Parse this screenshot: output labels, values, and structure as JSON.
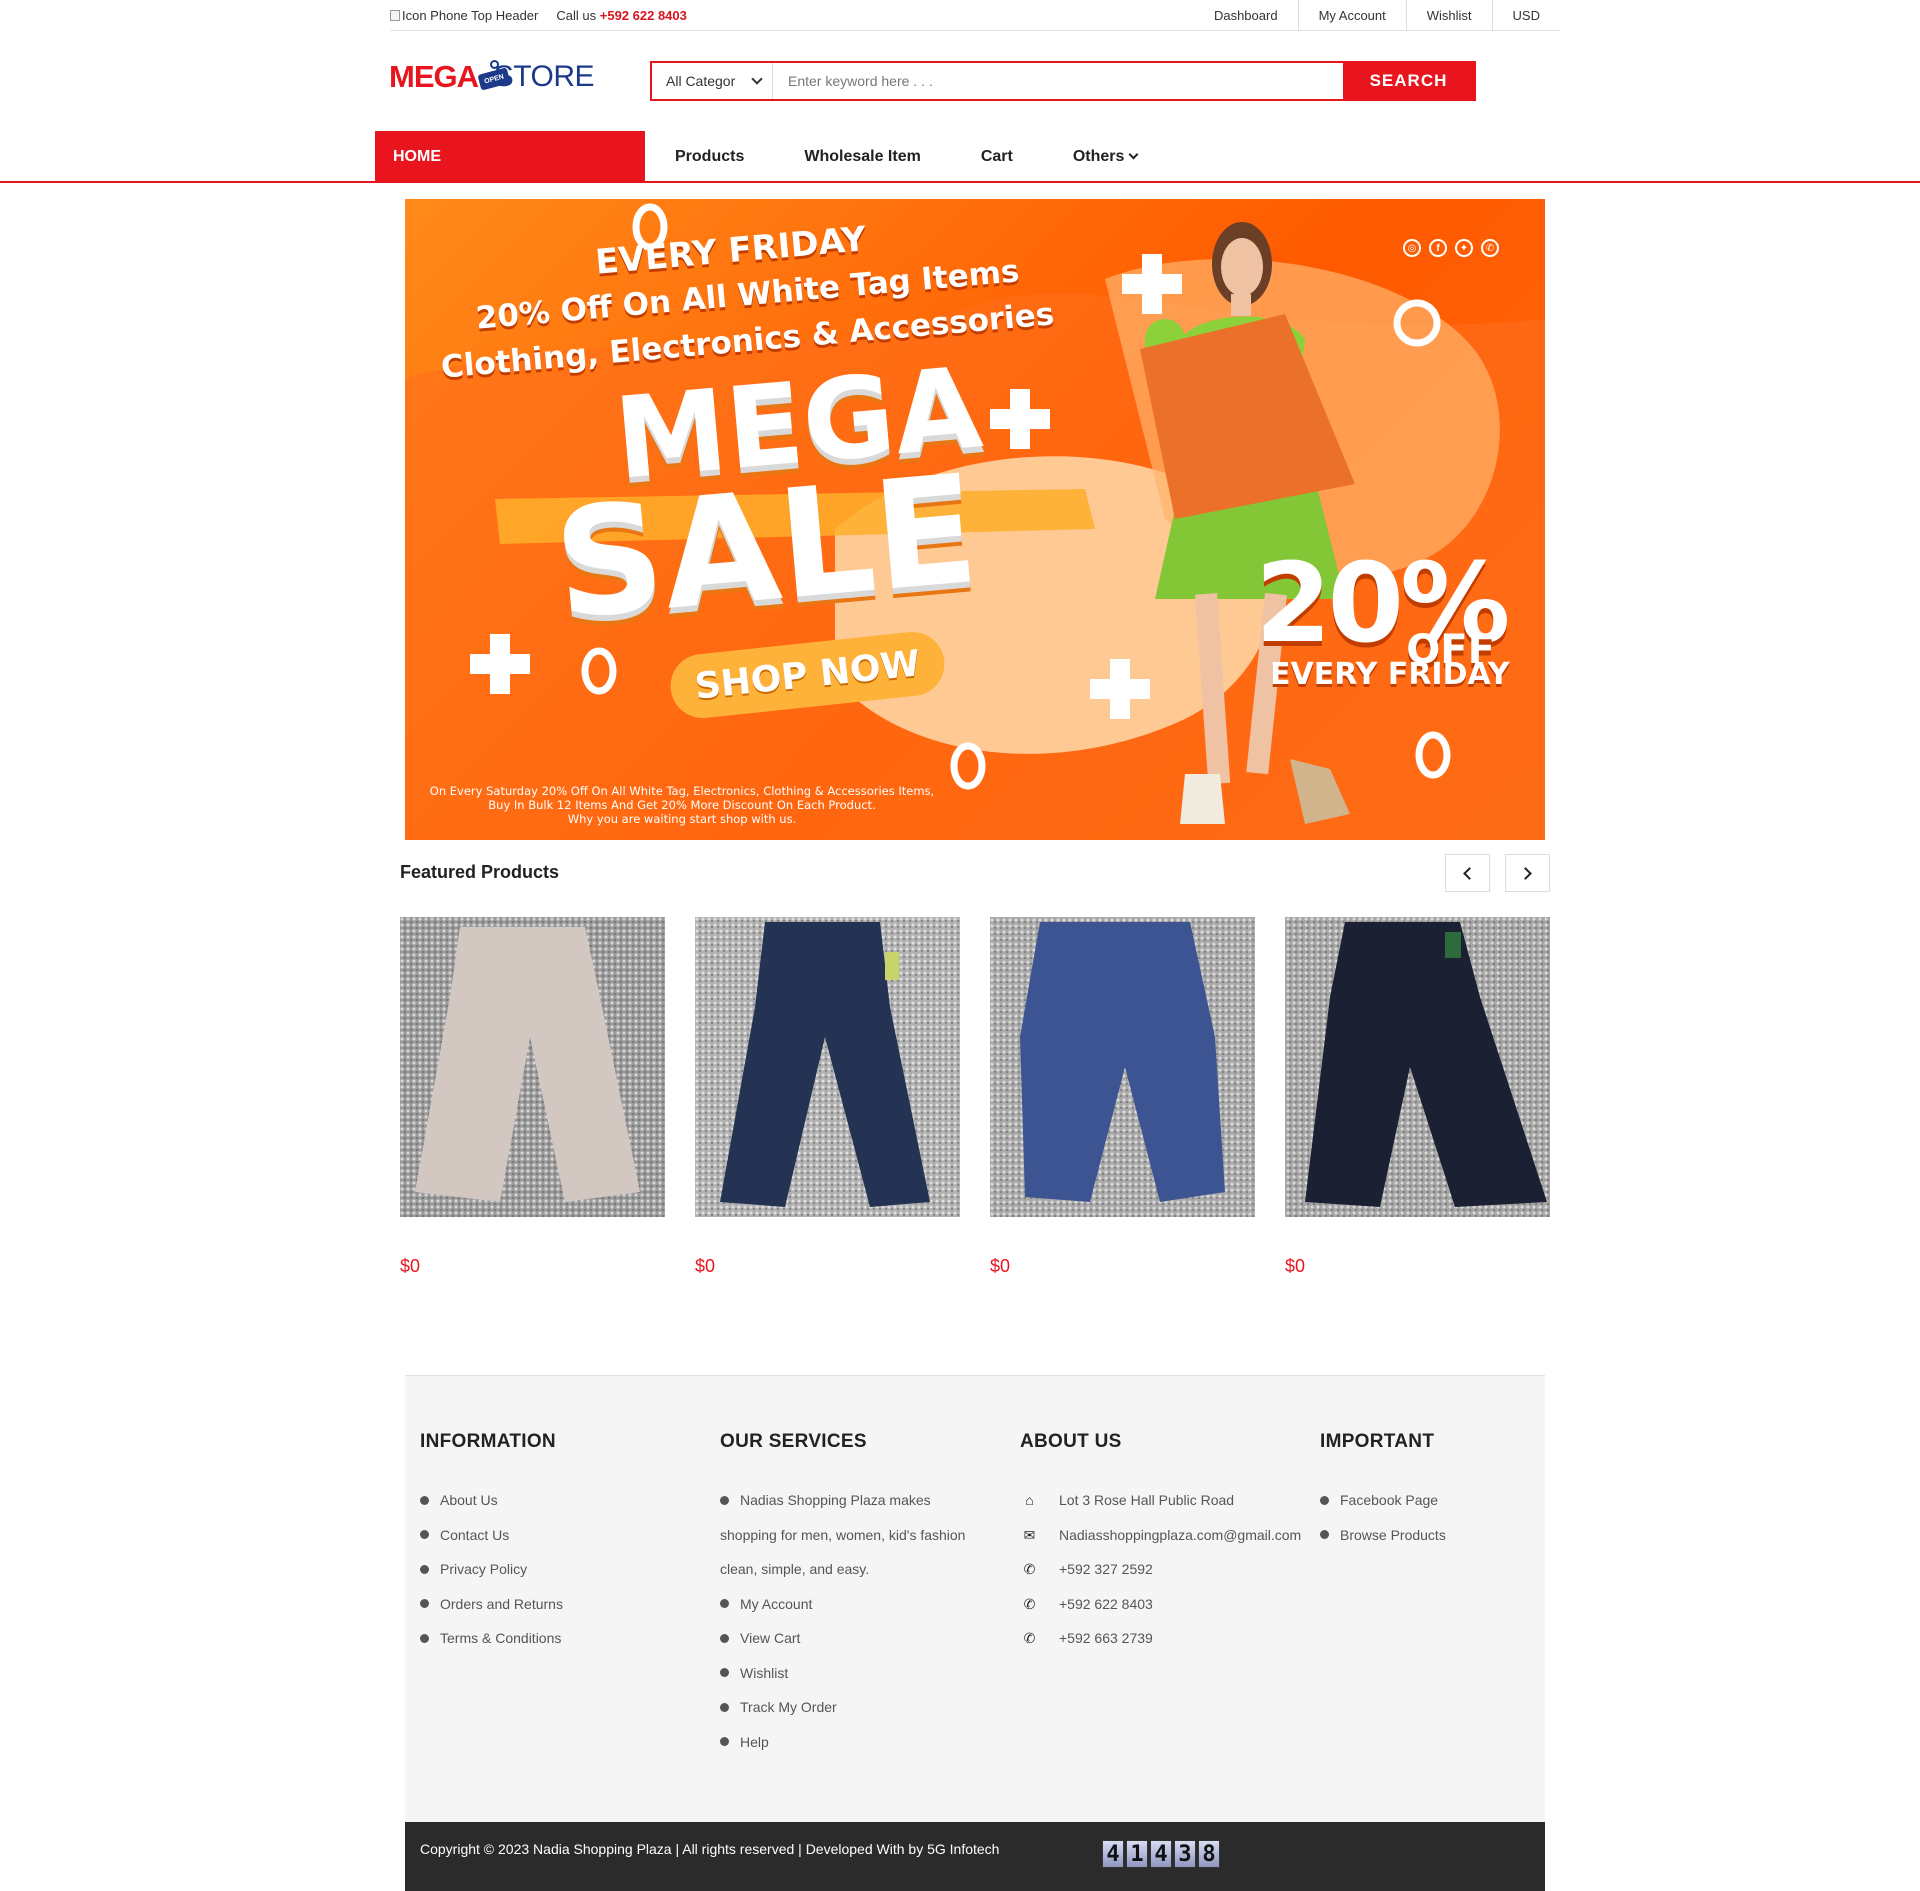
{
  "topbar": {
    "phone_icon_alt": "Icon Phone Top Header",
    "call_label": "Call us",
    "call_number": "+592 622 8403",
    "links": [
      "Dashboard",
      "My Account",
      "Wishlist",
      "USD"
    ]
  },
  "logo": {
    "mega": "MEGA",
    "sign": "OPEN",
    "store": "STORE"
  },
  "search": {
    "category": "All Categor",
    "placeholder": "Enter keyword here . . .",
    "button": "SEARCH"
  },
  "nav": {
    "home": "HOME",
    "items": [
      "Products",
      "Wholesale Item",
      "Cart",
      "Others"
    ]
  },
  "banner": {
    "line1": "EVERY FRIDAY",
    "line2": "20% Off On All White Tag Items",
    "line3": "Clothing, Electronics & Accessories",
    "mega": "MEGA",
    "sale": "SALE",
    "shop_now": "SHOP NOW",
    "percent": "20%",
    "off": "OFF",
    "every_friday": "EVERY FRIDAY",
    "note1": "On Every Saturday 20% Off On All White Tag, Electronics, Clothing & Accessories Items,",
    "note2": "Buy In Bulk 12 Items And Get 20% More Discount On Each Product.",
    "note3": "Why you are waiting start shop with us."
  },
  "featured": {
    "title": "Featured Products",
    "products": [
      {
        "price": "$0",
        "color": "#d3c7c1"
      },
      {
        "price": "$0",
        "color": "#243353"
      },
      {
        "price": "$0",
        "color": "#3d5493"
      },
      {
        "price": "$0",
        "color": "#1b2132"
      }
    ]
  },
  "footer": {
    "information": {
      "title": "INFORMATION",
      "items": [
        "About Us",
        "Contact Us",
        "Privacy Policy",
        "Orders and Returns",
        "Terms & Conditions"
      ]
    },
    "services": {
      "title": "OUR SERVICES",
      "desc1": "Nadias Shopping Plaza makes",
      "desc2": "shopping for men, women, kid's fashion",
      "desc3": "clean, simple, and easy.",
      "items": [
        "My Account",
        "View Cart",
        "Wishlist",
        "Track My Order",
        "Help"
      ]
    },
    "about": {
      "title": "ABOUT US",
      "address": "Lot 3 Rose Hall Public Road",
      "email": "Nadiasshoppingplaza.com@gmail.com",
      "phones": [
        "+592 327 2592",
        "+592 622 8403",
        "+592 663 2739"
      ]
    },
    "important": {
      "title": "IMPORTANT",
      "items": [
        "Facebook Page",
        "Browse Products"
      ]
    },
    "copyright": "Copyright © 2023 Nadia Shopping Plaza | All rights reserved | Developed With by 5G Infotech",
    "counter": [
      "4",
      "1",
      "4",
      "3",
      "8"
    ]
  },
  "colors": {
    "brand_red": "#e8151f",
    "brand_blue": "#1d3a8a",
    "banner_orange": "#ff5a00",
    "footer_dark": "#2b2b2b"
  }
}
